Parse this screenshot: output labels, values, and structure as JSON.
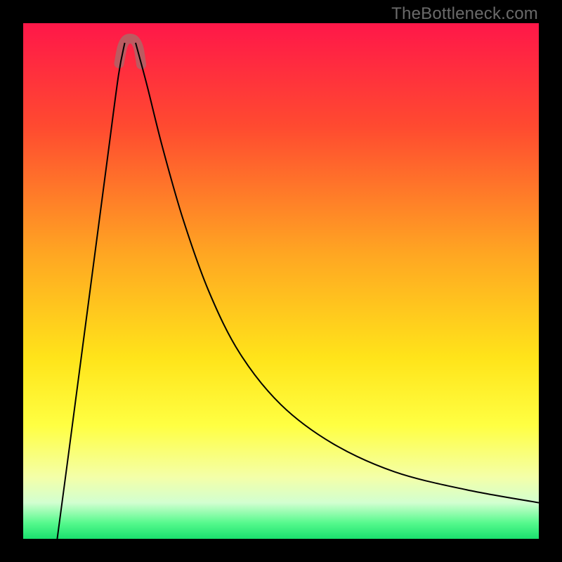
{
  "watermark": "TheBottleneck.com",
  "accent_color": "#bb5b61",
  "chart_data": {
    "type": "line",
    "title": "",
    "xlabel": "",
    "ylabel": "",
    "xlim": [
      0,
      1
    ],
    "ylim": [
      0,
      1
    ],
    "gradient_stops": [
      {
        "offset": 0.0,
        "color": "#ff1749"
      },
      {
        "offset": 0.2,
        "color": "#ff4a30"
      },
      {
        "offset": 0.45,
        "color": "#ffa722"
      },
      {
        "offset": 0.65,
        "color": "#ffe41a"
      },
      {
        "offset": 0.78,
        "color": "#ffff42"
      },
      {
        "offset": 0.88,
        "color": "#f4ffa8"
      },
      {
        "offset": 0.93,
        "color": "#d2ffd0"
      },
      {
        "offset": 0.97,
        "color": "#54f98c"
      },
      {
        "offset": 1.0,
        "color": "#1ae06e"
      }
    ],
    "series": [
      {
        "name": "left-branch",
        "x": [
          0.066,
          0.09,
          0.115,
          0.14,
          0.165,
          0.185,
          0.197
        ],
        "y": [
          0.0,
          0.18,
          0.37,
          0.56,
          0.75,
          0.9,
          0.962
        ]
      },
      {
        "name": "right-branch",
        "x": [
          0.218,
          0.24,
          0.27,
          0.31,
          0.36,
          0.42,
          0.5,
          0.6,
          0.72,
          0.86,
          1.0
        ],
        "y": [
          0.962,
          0.88,
          0.76,
          0.62,
          0.48,
          0.36,
          0.26,
          0.185,
          0.13,
          0.095,
          0.07
        ]
      }
    ],
    "valley_marker": {
      "name": "valley-outline",
      "color": "#bb5b61",
      "stroke_width_px": 14,
      "x": [
        0.186,
        0.192,
        0.199,
        0.208,
        0.217,
        0.224,
        0.229
      ],
      "y": [
        0.922,
        0.953,
        0.967,
        0.97,
        0.966,
        0.951,
        0.92
      ]
    }
  }
}
